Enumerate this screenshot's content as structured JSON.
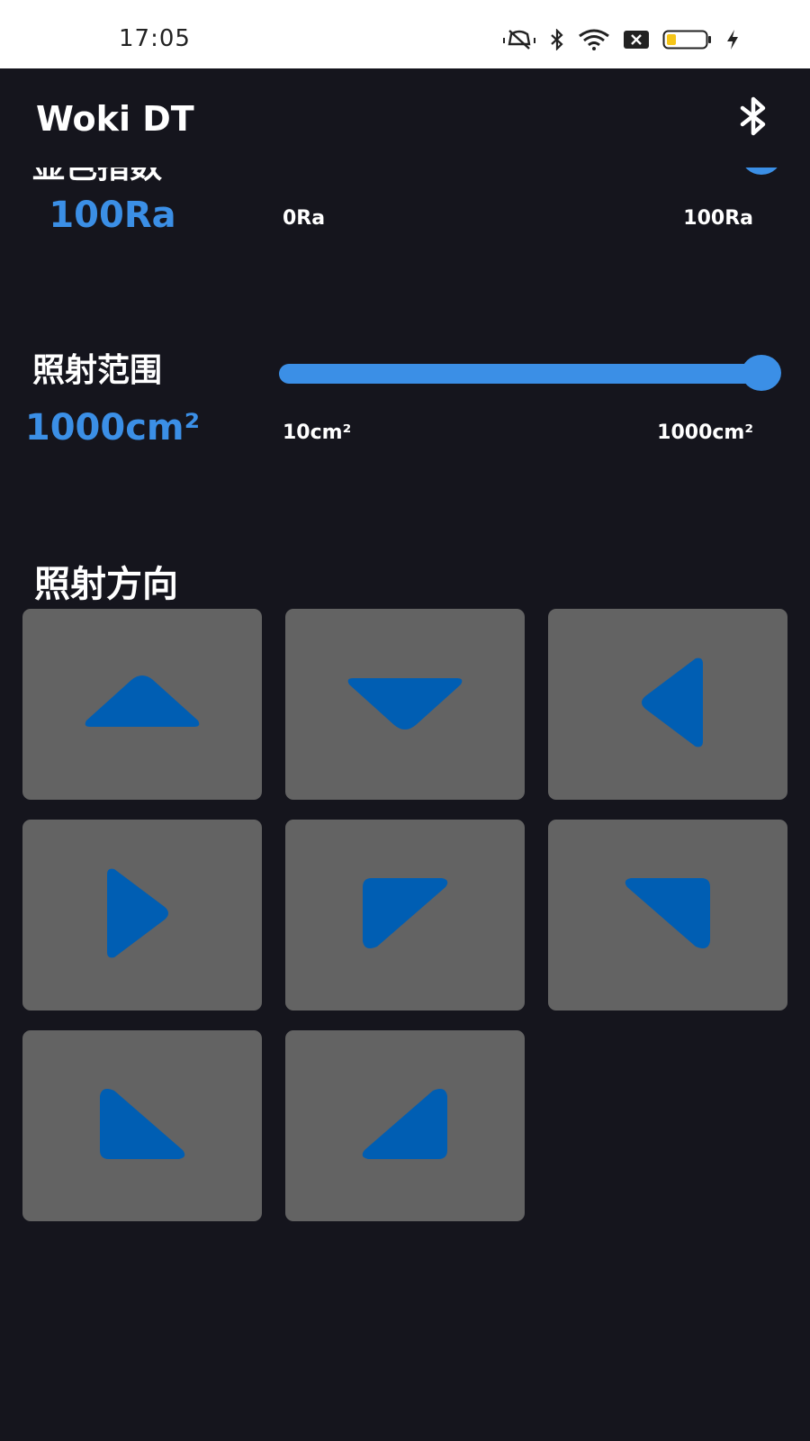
{
  "status_bar": {
    "time": "17:05",
    "icons": [
      "mute-vibrate-icon",
      "bluetooth-icon",
      "wifi-icon",
      "no-sim-icon",
      "battery-low-icon",
      "charging-icon"
    ],
    "battery_level_percent": 20
  },
  "app_bar": {
    "title": "Woki DT",
    "action_icon": "bluetooth-icon"
  },
  "sections": {
    "cri": {
      "label": "显色指数",
      "value": "100Ra",
      "min": "0Ra",
      "max": "100Ra",
      "level_fraction": 1.0
    },
    "range": {
      "label": "照射范围",
      "value": "1000cm²",
      "min": "10cm²",
      "max": "1000cm²",
      "level_fraction": 1.0
    }
  },
  "direction": {
    "title": "照射方向",
    "buttons": [
      {
        "icon": "arrow-up-icon"
      },
      {
        "icon": "arrow-down-icon"
      },
      {
        "icon": "arrow-left-icon"
      },
      {
        "icon": "arrow-right-icon"
      },
      {
        "icon": "arrow-up-left-icon"
      },
      {
        "icon": "arrow-up-right-icon"
      },
      {
        "icon": "arrow-down-left-icon"
      },
      {
        "icon": "arrow-down-right-icon"
      }
    ]
  },
  "colors": {
    "background": "#15151d",
    "accent": "#3b8fe6",
    "button_bg": "#636363",
    "arrow": "#005eb3"
  }
}
